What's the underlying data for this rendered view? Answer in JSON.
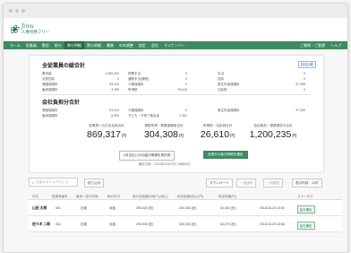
{
  "app": {
    "logo_script": "Jimu",
    "logo_name": "人事労務フリー"
  },
  "nav": {
    "items": [
      "ホーム",
      "従業員",
      "勤怠",
      "給与",
      "賞与明細",
      "賞与明細",
      "書類",
      "年末調整",
      "設定",
      "会社",
      "マイナンバー"
    ],
    "active_index": 4,
    "right_items": [
      "ご質問・ご要望",
      "ヘルプ"
    ]
  },
  "summary": {
    "employee_title": "全従業員の総合計",
    "badge": "前月比較",
    "employee_rows": [
      {
        "label": "基本給",
        "value": "1,050,000",
        "label2": "残業手当",
        "value2": "0",
        "label3": "手当",
        "value3": "0"
      },
      {
        "label": "欠勤控除",
        "value": "0",
        "label2": "通勤手当(課税)",
        "value2": "0",
        "label3": "控除",
        "value3": "0"
      },
      {
        "label": "健康保険料",
        "value": "53,010",
        "label2": "介護保険料",
        "value2": "0",
        "label3": "厚生年金保険料",
        "value3": "97,365"
      },
      {
        "label": "雇用保険料",
        "value": "3,150",
        "label2": "所得税",
        "value2": "26,610",
        "label3": "住民税",
        "value3": "0"
      }
    ],
    "company_title": "会社負担分合計",
    "company_rows": [
      {
        "label": "健康保険料",
        "value": "53,010",
        "label2": "介護保険料",
        "value2": "0",
        "label3": "厚生年金保険料",
        "value3": "97,365"
      },
      {
        "label": "雇用保険料",
        "value": "6,300",
        "label2": "子ども・子育て拠出金",
        "value2": "2,481",
        "label3": "",
        "value3": ""
      }
    ],
    "totals": [
      {
        "label": "従業員へのお支払総合計",
        "value": "869,317",
        "unit": "円"
      },
      {
        "label": "源泉所得・健康保険総合計",
        "value": "304,308",
        "unit": "円"
      },
      {
        "label": "所得税・住民税合計",
        "value": "26,610",
        "unit": "円"
      },
      {
        "label": "会社負担・源泉徴収の合計",
        "value": "1,200,235",
        "unit": "円"
      }
    ],
    "button_outline": "1月支払い分の給与明細を再計算",
    "button_green": "全員分の給与明細を確定",
    "calc_note": "確定日時：2018年04月23日 18時48分"
  },
  "toolbar": {
    "search_placeholder": "氏名やメールアドレス",
    "filter_label": "絞り込み",
    "download_label": "ダウンロード",
    "btn2_label": "一括操作",
    "btn3_label": "一括確定",
    "per_page_label": "表示件数：10件"
  },
  "table": {
    "headers": [
      "氏名",
      "従業員番号",
      "雇用・給与形態",
      "締日年月",
      "差引支給額(手取り)(税込)",
      "総支給額(税込)(円)",
      "総控除額(円)",
      "",
      "ステータス"
    ],
    "rows": [
      {
        "name": "山田 太郎",
        "number": "001",
        "type": "社員",
        "month": "月給",
        "net": "250,000 (計)",
        "gross": "300,000 (計)",
        "deduct": "40,000 (計)",
        "date": "2018-04-23 19:40",
        "status": "給与確定"
      },
      {
        "name": "佐々木 二郎",
        "number": "002",
        "type": "社員",
        "month": "月給",
        "net": "290,000 (計)",
        "gross": "300,000 (計)",
        "deduct": "60,279 (計)",
        "date": "2018-04-23 18:48",
        "status": "給与確定"
      }
    ]
  }
}
